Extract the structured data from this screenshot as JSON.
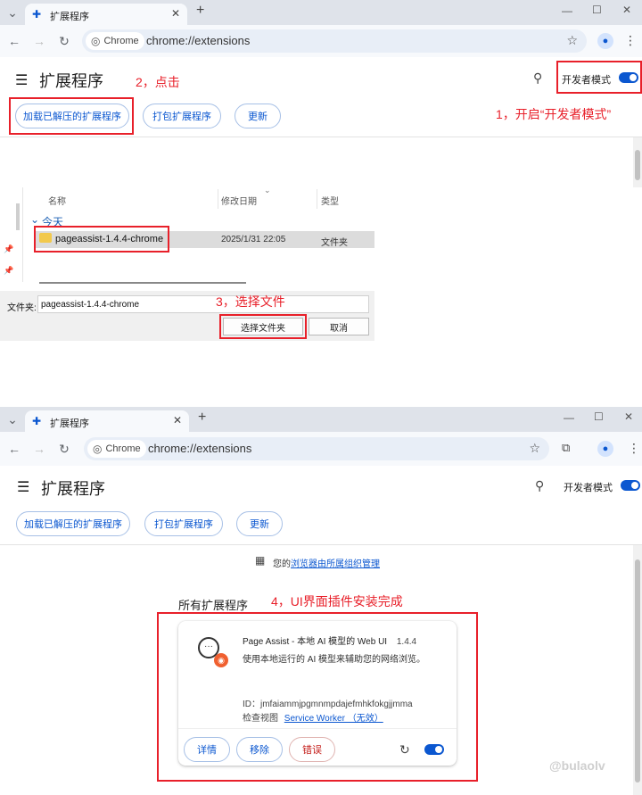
{
  "top": {
    "tab_title": "扩展程序",
    "chrome_chip": "Chrome",
    "url": "chrome://extensions",
    "page_title": "扩展程序",
    "dev_mode_label": "开发者模式",
    "dev_mode_on": true,
    "buttons": [
      "加载已解压的扩展程序",
      "打包扩展程序",
      "更新"
    ]
  },
  "annotations": {
    "step1": "1，开启“开发者模式”",
    "step2": "2，点击",
    "step3": "3，选择文件",
    "step4": "4，UI界面插件安装完成"
  },
  "file_dialog": {
    "columns": [
      "名称",
      "修改日期",
      "类型"
    ],
    "group": "今天",
    "row": {
      "name": "pageassist-1.4.4-chrome",
      "date": "2025/1/31 22:05",
      "type": "文件夹"
    },
    "folder_label": "文件夹:",
    "folder_value": "pageassist-1.4.4-chrome",
    "select_button": "选择文件夹",
    "cancel_button": "取消"
  },
  "bottom": {
    "tab_title": "扩展程序",
    "chrome_chip": "Chrome",
    "url": "chrome://extensions",
    "page_title": "扩展程序",
    "dev_mode_label": "开发者模式",
    "buttons": [
      "加载已解压的扩展程序",
      "打包扩展程序",
      "更新"
    ],
    "managed_prefix": "您的",
    "managed_link": "浏览器由所属组织管理",
    "all_extensions": "所有扩展程序",
    "extension": {
      "name": "Page Assist - 本地 AI 模型的 Web UI",
      "version": "1.4.4",
      "description": "使用本地运行的 AI 模型来辅助您的网络浏览。",
      "id_line": "ID：jmfaiammjpgmnmpdajefmhkfokgjjmma",
      "inspect_label": "检查视图",
      "inspect_link": "Service Worker （无效）",
      "details": "详情",
      "remove": "移除",
      "errors": "错误",
      "enabled": true
    }
  },
  "watermark": "@bulaolv",
  "colors": {
    "accent": "#0b57d0",
    "annotation_red": "#e8202a",
    "tabbar": "#dfe3ea"
  }
}
